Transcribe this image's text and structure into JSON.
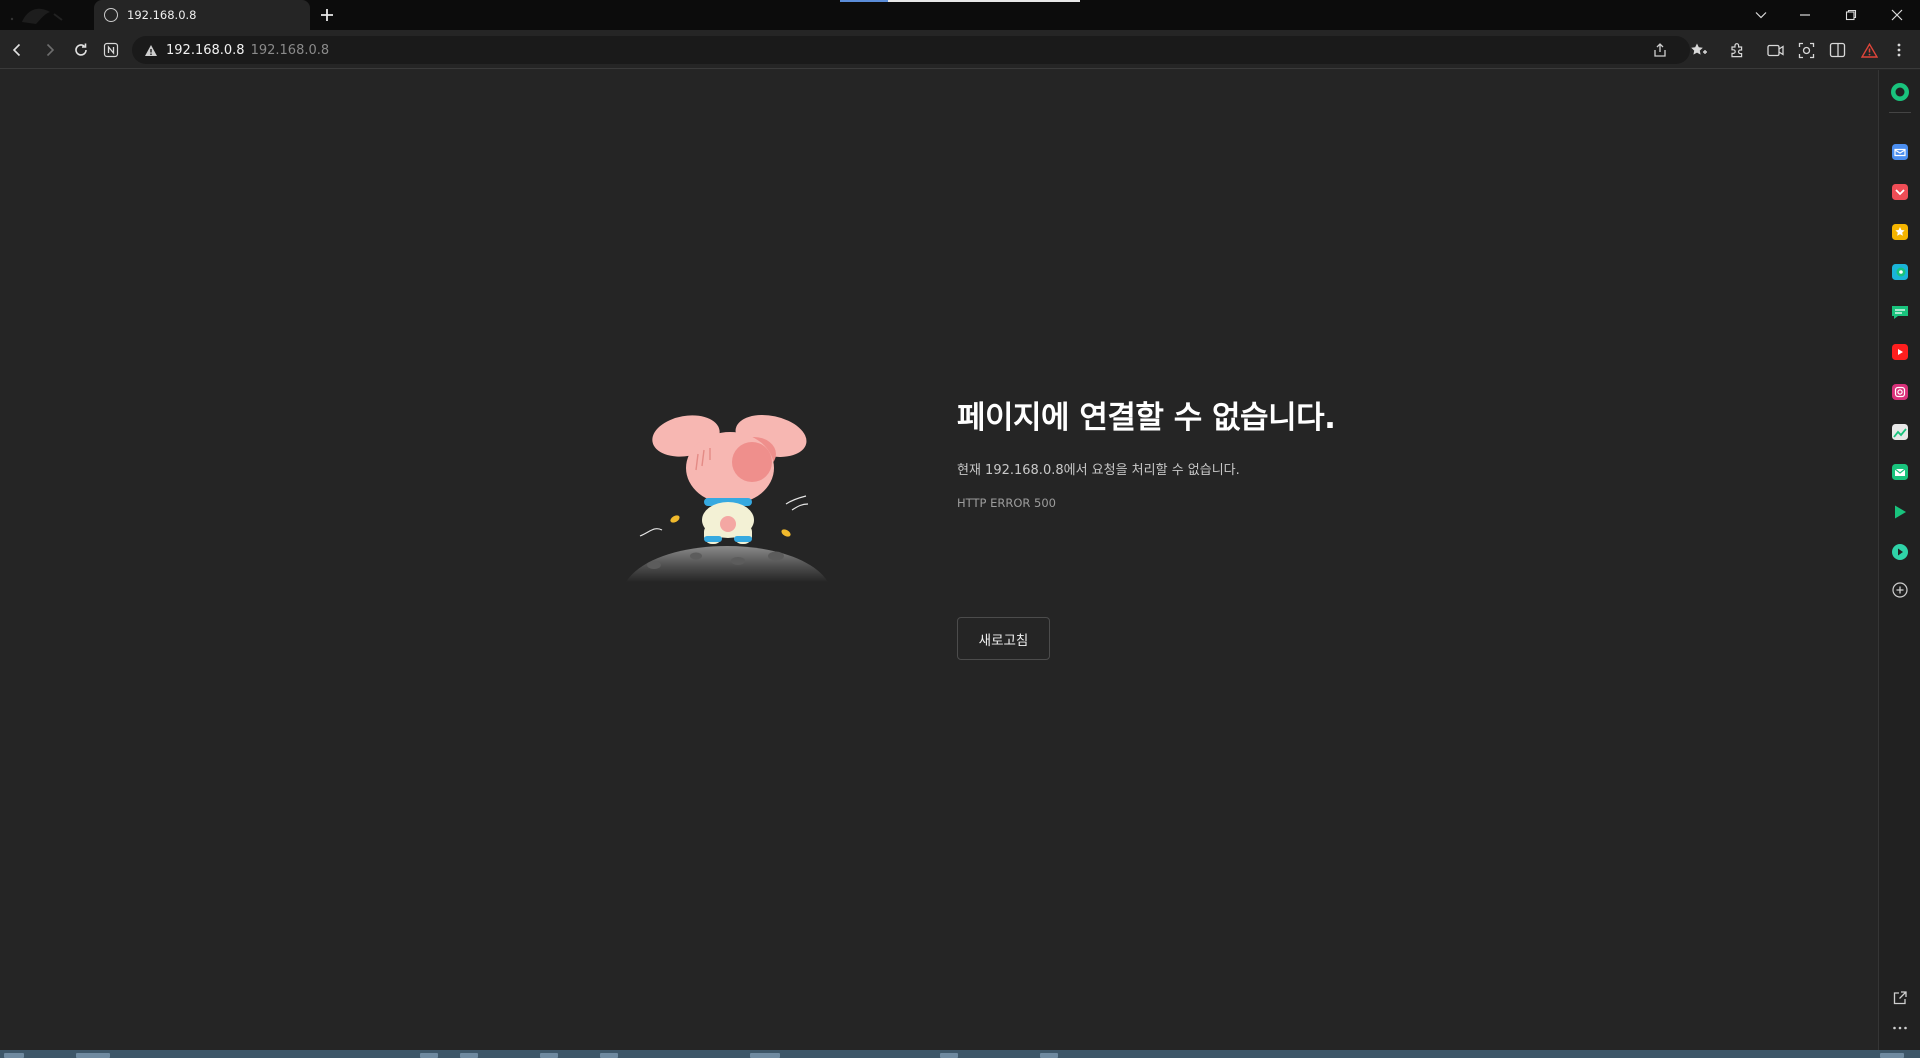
{
  "tab": {
    "title": "192.168.0.8"
  },
  "omnibox": {
    "host": "192.168.0.8",
    "rest": "192.168.0.8"
  },
  "error": {
    "title": "페이지에 연결할 수 없습니다.",
    "description": "현재 192.168.0.8에서 요청을 처리할 수 없습니다.",
    "code": "HTTP ERROR 500",
    "reload_label": "새로고침"
  },
  "icons": {
    "tab_favicon": "globe-icon",
    "new_tab": "plus-icon",
    "back": "chevron-left-icon",
    "forward": "chevron-right-icon",
    "reload": "reload-icon",
    "naver": "naver-n-icon",
    "security": "warning-triangle-icon",
    "share": "share-icon",
    "favorites": "star-plus-icon",
    "extensions": "puzzle-icon",
    "video": "video-icon",
    "capture": "capture-icon",
    "split": "split-view-icon",
    "alert": "alert-icon",
    "menu": "more-vertical-icon",
    "window_controls": [
      "chevron-down-icon",
      "minimize-icon",
      "restore-icon",
      "close-icon"
    ],
    "sidebar": [
      "whale-space-icon",
      "mail-icon",
      "pocket-icon",
      "favorites-star-icon",
      "papago-icon",
      "webtoon-icon",
      "youtube-icon",
      "instagram-icon",
      "stocks-icon",
      "naver-mail-icon",
      "play-icon",
      "music-icon",
      "add-icon",
      "open-external-icon",
      "more-horizontal-icon"
    ]
  },
  "colors": {
    "page_bg": "#252525",
    "titlebar_bg": "#0c0c0c",
    "sidebar_green": "#19c37d",
    "alert_red": "#e0453a"
  }
}
